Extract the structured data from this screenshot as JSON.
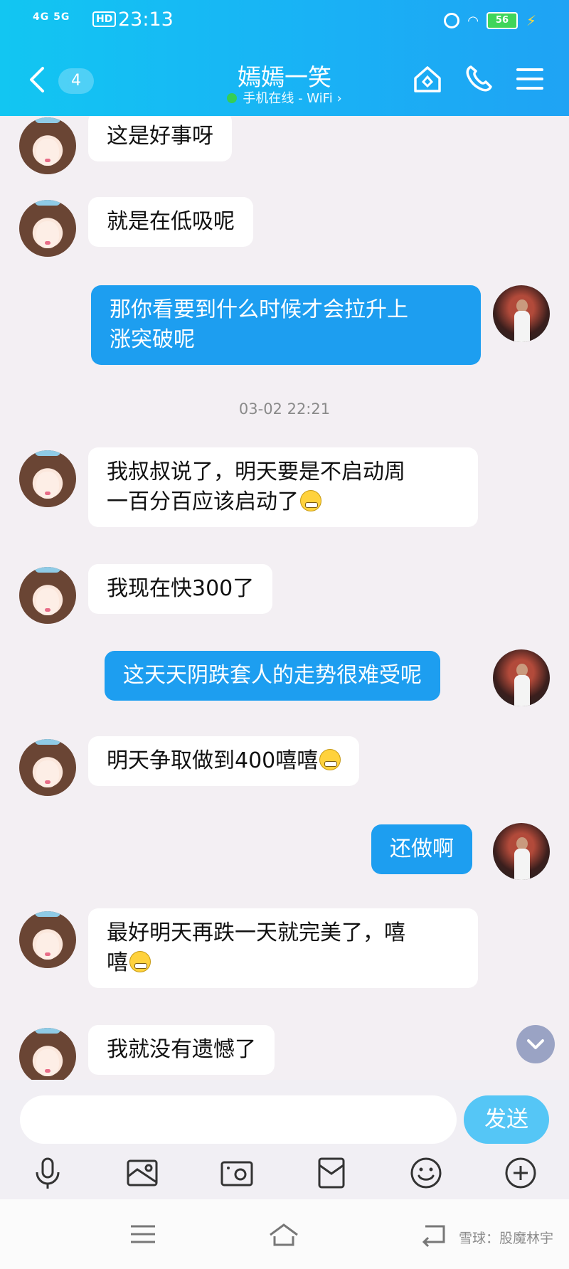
{
  "status_bar": {
    "signal": "4G 5G",
    "hd": "HD",
    "time": "23:13",
    "battery": "56"
  },
  "header": {
    "back_icon": "chevron-left-icon",
    "unread_count": "4",
    "title": "嫣嫣一笑",
    "subtitle": "手机在线 - WiFi ›",
    "online_color": "#37d04d",
    "icons": [
      "home-icon",
      "phone-icon",
      "menu-icon"
    ],
    "background": "#19b2f5"
  },
  "messages": [
    {
      "side": "in",
      "text": "这是好事呀"
    },
    {
      "side": "in",
      "text": "就是在低吸呢"
    },
    {
      "side": "out",
      "text": "那你看要到什么时候才会拉升上",
      "text2": "涨突破呢"
    },
    {
      "side": "in",
      "text": "我叔叔说了，明天要是不启动周",
      "text2": "一百分百应该启动了",
      "emoji": "pleading-face-emoji"
    },
    {
      "side": "in",
      "text": "我现在快300了"
    },
    {
      "side": "out",
      "text": "这天天阴跌套人的走势很难受呢"
    },
    {
      "side": "in",
      "text": "明天争取做到400嘻嘻",
      "emoji": "grimacing-face-emoji"
    },
    {
      "side": "out",
      "text": "还做啊"
    },
    {
      "side": "in",
      "text": "最好明天再跌一天就完美了，嘻",
      "text2": "嘻",
      "emoji": "grimacing-face-emoji"
    },
    {
      "side": "in",
      "text": "我就没有遗憾了"
    }
  ],
  "timestamp": "03-02 22:21",
  "input": {
    "placeholder": "",
    "send_label": "发送",
    "send_color": "#55c6f6"
  },
  "toolbar": [
    "microphone-icon",
    "image-icon",
    "camera-icon",
    "red-packet-icon",
    "smiley-icon",
    "plus-icon"
  ],
  "nav": [
    "menu-icon",
    "home-icon",
    "back-icon"
  ],
  "watermark": "雪球：股魔林宇"
}
